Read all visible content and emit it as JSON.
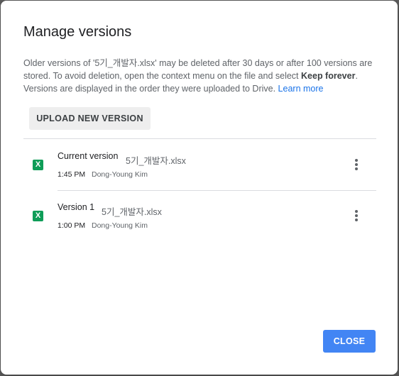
{
  "dialog": {
    "title": "Manage versions",
    "description": {
      "part1": "Older versions of '5기_개발자.xlsx' may be deleted after 30 days or after 100 versions are stored. To avoid deletion, open the context menu on the file and select ",
      "bold": "Keep forever",
      "part2": ". Versions are displayed in the order they were uploaded to Drive. ",
      "link": "Learn more"
    },
    "upload_label": "UPLOAD NEW VERSION",
    "close_label": "CLOSE"
  },
  "versions": [
    {
      "label": "Current version",
      "file_name": "5기_개발자.xlsx",
      "time": "1:45 PM",
      "author": "Dong-Young Kim",
      "icon": "excel-file-icon",
      "icon_letter": "X"
    },
    {
      "label": "Version 1",
      "file_name": "5기_개발자.xlsx",
      "time": "1:00 PM",
      "author": "Dong-Young Kim",
      "icon": "excel-file-icon",
      "icon_letter": "X"
    }
  ],
  "colors": {
    "accent": "#4285f4",
    "link": "#1a73e8",
    "excel_green": "#0f9d58"
  }
}
